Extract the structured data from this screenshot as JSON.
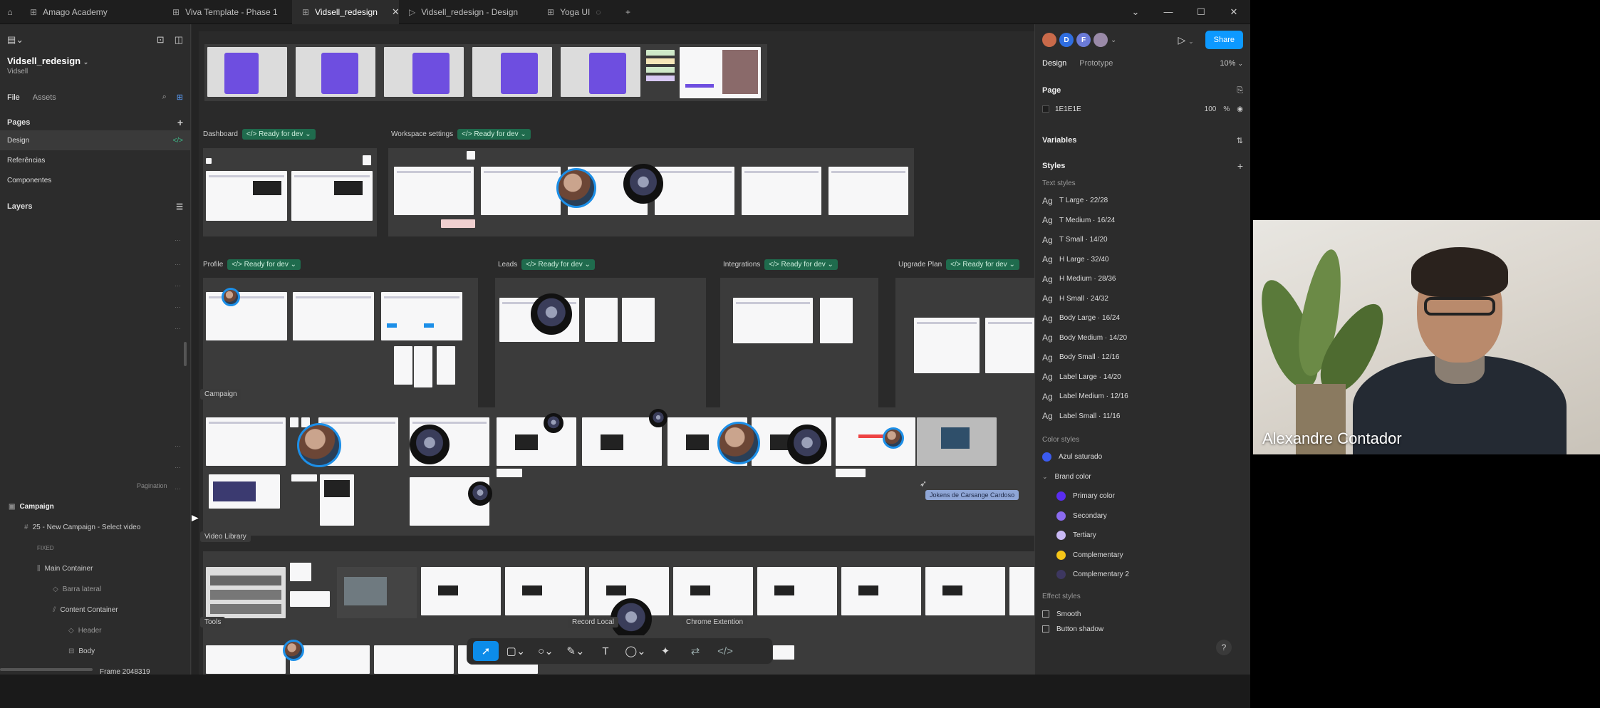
{
  "tabs": [
    {
      "label": "Amago Academy",
      "icon": "grid-icon"
    },
    {
      "label": "Viva Template - Phase 1",
      "icon": "grid-icon"
    },
    {
      "label": "Vidsell_redesign",
      "icon": "grid-icon",
      "active": true
    },
    {
      "label": "Vidsell_redesign - Design",
      "icon": "play-icon"
    },
    {
      "label": "Yoga UI",
      "icon": "grid-icon"
    }
  ],
  "left": {
    "project_title": "Vidsell_redesign",
    "project_sub": "Vidsell",
    "tab_file": "File",
    "tab_assets": "Assets",
    "pages_heading": "Pages",
    "pages": [
      {
        "label": "Design",
        "selected": true
      },
      {
        "label": "Referências"
      },
      {
        "label": "Componentes"
      }
    ],
    "layers_heading": "Layers",
    "pagination_label": "Pagination",
    "layers": [
      {
        "label": "Campaign",
        "indent": 0
      },
      {
        "label": "25 - New Campaign - Select video",
        "indent": 1
      },
      {
        "label": "FIXED",
        "indent": 2
      },
      {
        "label": "Main Container",
        "indent": 2
      },
      {
        "label": "Barra lateral",
        "indent": 3
      },
      {
        "label": "Content Container",
        "indent": 3
      },
      {
        "label": "Header",
        "indent": 4
      },
      {
        "label": "Body",
        "indent": 4
      },
      {
        "label": "Frame 2048319",
        "indent": 5
      }
    ]
  },
  "canvas": {
    "sections": {
      "dashboard": "Dashboard",
      "workspace": "Workspace settings",
      "profile": "Profile",
      "leads": "Leads",
      "integrations": "Integrations",
      "upgrade": "Upgrade Plan",
      "campaign": "Campaign",
      "video_library": "Video Library",
      "tools": "Tools",
      "record_local": "Record Local",
      "chrome_extension": "Chrome Extention"
    },
    "ready_label": "Ready for dev",
    "comment_pill": "Jokens de Carsange Cardoso"
  },
  "toolbar": {
    "tools": [
      "move-icon",
      "frame-icon",
      "ellipse-icon",
      "pen-icon",
      "text-icon",
      "comment-icon",
      "actions-icon",
      "dev-mode-icon",
      "code-icon"
    ]
  },
  "right": {
    "tab_design": "Design",
    "tab_prototype": "Prototype",
    "zoom": "10%",
    "share": "Share",
    "avatars": [
      "D",
      "F"
    ],
    "page_heading": "Page",
    "page_color": "1E1E1E",
    "page_opacity": "100",
    "page_opacity_unit": "%",
    "variables_heading": "Variables",
    "styles_heading": "Styles",
    "text_styles_heading": "Text styles",
    "text_styles": [
      "T Large · 22/28",
      "T Medium · 16/24",
      "T Small · 14/20",
      "H Large · 32/40",
      "H Medium · 28/36",
      "H Small · 24/32",
      "Body Large · 16/24",
      "Body Medium · 14/20",
      "Body Small · 12/16",
      "Label Large · 14/20",
      "Label Medium · 12/16",
      "Label Small · 11/16"
    ],
    "ag": "Ag",
    "color_styles_heading": "Color styles",
    "color_styles": [
      {
        "label": "Azul saturado",
        "color": "#3b5bf0",
        "indent": 0
      },
      {
        "label": "Brand color",
        "color": "",
        "indent": 0,
        "group": true
      },
      {
        "label": "Primary color",
        "color": "#5a2df0",
        "indent": 1
      },
      {
        "label": "Secondary",
        "color": "#8b6bf0",
        "indent": 1
      },
      {
        "label": "Tertiary",
        "color": "#c9b9f5",
        "indent": 1
      },
      {
        "label": "Complementary",
        "color": "#f5c518",
        "indent": 1
      },
      {
        "label": "Complementary 2",
        "color": "#3d3760",
        "indent": 1
      }
    ],
    "effect_styles_heading": "Effect styles",
    "effect_styles": [
      "Smooth",
      "Button shadow"
    ]
  },
  "video": {
    "name": "Alexandre Contador"
  }
}
